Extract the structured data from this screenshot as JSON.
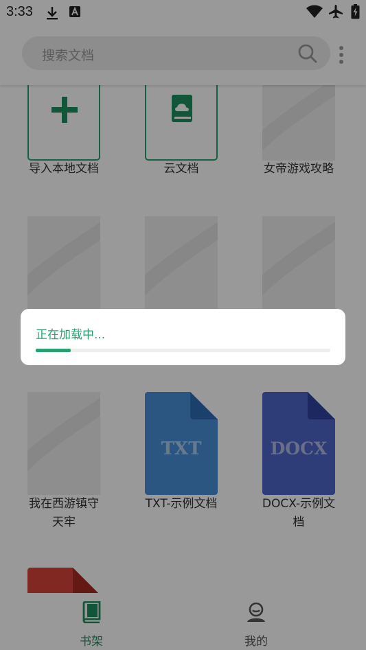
{
  "status_bar": {
    "time": "3:33",
    "icons": [
      "download-icon",
      "a-notification-icon",
      "wifi-icon",
      "airplane-icon",
      "battery-icon"
    ]
  },
  "search": {
    "placeholder": "搜索文档"
  },
  "books": [
    {
      "title": "导入本地文档",
      "cover": "add-icon"
    },
    {
      "title": "云文档",
      "cover": "cloud-book-icon"
    },
    {
      "title": "女帝游戏攻略",
      "cover": "placeholder"
    },
    {
      "title": "",
      "cover": "placeholder"
    },
    {
      "title": "",
      "cover": "placeholder"
    },
    {
      "title": "",
      "cover": "placeholder"
    },
    {
      "title": "我在西游镇守天牢",
      "cover": "placeholder",
      "title_line1": "我在西游镇守",
      "title_line2": "天牢"
    },
    {
      "title": "TXT-示例文档",
      "cover": "txt-file",
      "badge": "TXT"
    },
    {
      "title": "DOCX-示例文档",
      "cover": "docx-file",
      "badge": "DOCX",
      "title_line1": "DOCX-示例文",
      "title_line2": "档"
    }
  ],
  "dialog": {
    "text": "正在加载中...",
    "progress": 0.12
  },
  "bottom_nav": {
    "items": [
      {
        "label": "书架",
        "icon": "bookshelf-icon",
        "active": true
      },
      {
        "label": "我的",
        "icon": "profile-icon",
        "active": false
      }
    ]
  },
  "colors": {
    "accent": "#27a270",
    "txt_file": "#4a90d9",
    "docx_file": "#4d64c7",
    "pdf_file": "#d9443b"
  }
}
